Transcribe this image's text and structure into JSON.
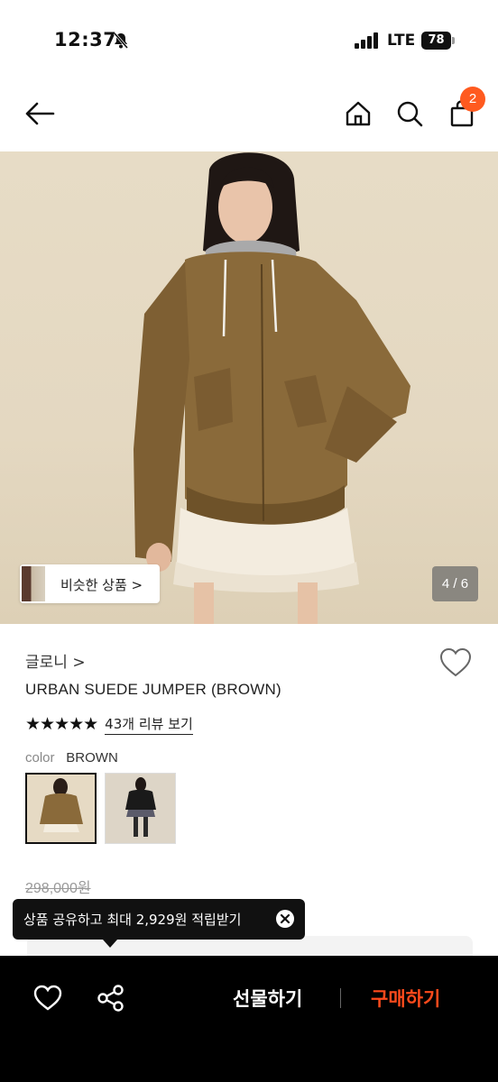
{
  "status_bar": {
    "time": "12:37",
    "network": "LTE",
    "battery": "78"
  },
  "header": {
    "cart_count": "2"
  },
  "gallery": {
    "similar_label": "비슷한 상품 >",
    "page_indicator": "4 / 6"
  },
  "product": {
    "brand": "글로니 >",
    "name": "URBAN SUEDE JUMPER (BROWN)",
    "stars": "★★★★★",
    "review_link": "43개 리뷰 보기",
    "color_label": "color",
    "color_value": "BROWN",
    "original_price": "298,000원"
  },
  "tooltip": {
    "text": "상품 공유하고 최대 2,929원 적립받기"
  },
  "bottom_bar": {
    "gift_label": "선물하기",
    "buy_label": "구매하기"
  },
  "colors": {
    "accent": "#ff4a1c",
    "badge": "#ff5a1f",
    "jacket": "#8a6a3a"
  }
}
